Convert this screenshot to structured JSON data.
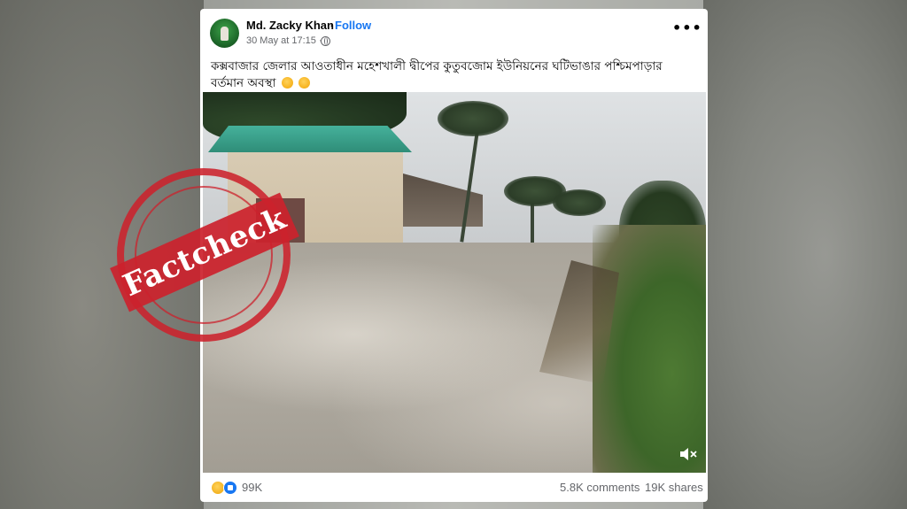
{
  "post": {
    "author": "Md. Zacky Khan",
    "separator": "·",
    "follow_label": "Follow",
    "timestamp": "30 May at 17:15 ·",
    "privacy_icon": "globe-icon",
    "more_label": "•••",
    "caption": "কক্সবাজার জেলার আওতাধীন মহেশখালী দ্বীপের কুতুবজোম ইউনিয়নের ঘটিভাঙার পশ্চিমপাড়ার বর্তমান অবস্থা"
  },
  "video": {
    "mute_icon": "speaker-muted-icon"
  },
  "stamp": {
    "text": "Factcheck",
    "color": "#cc222c"
  },
  "footer": {
    "reaction_icons": [
      "sad-reaction-icon",
      "like-reaction-icon"
    ],
    "reactions_count": "99K",
    "comments": "5.8K comments",
    "shares": "19K shares"
  },
  "colors": {
    "accent": "#1877f2",
    "muted_text": "#65676b"
  }
}
